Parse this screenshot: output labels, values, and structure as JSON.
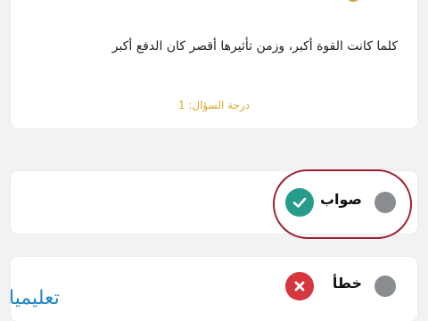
{
  "question": {
    "text": "كلما كانت القوة أكبر، وزمن تأثيرها أقصر كان الدفع أكبر",
    "score_label": "درجة السؤال: 1"
  },
  "options": [
    {
      "label": "صواب",
      "feedback_icon": "check-icon",
      "color": "#279c8b"
    },
    {
      "label": "خطأ",
      "feedback_icon": "x-icon",
      "color": "#d6363d"
    }
  ],
  "watermark": "تعليميا",
  "colors": {
    "highlight_ring": "#9c1f2e",
    "score_text": "#d8a92c",
    "radio": "#8a8d90"
  }
}
